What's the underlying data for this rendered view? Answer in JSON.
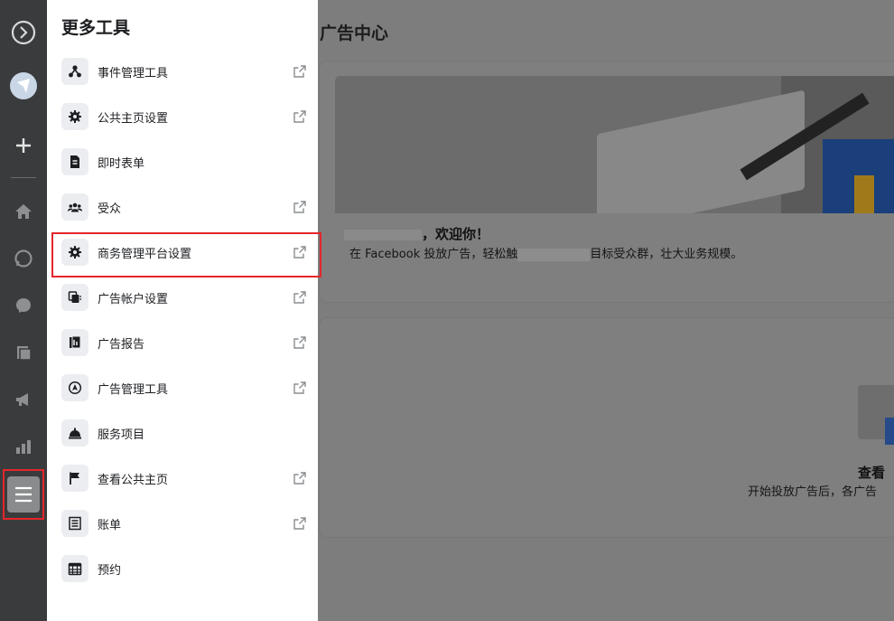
{
  "drawer": {
    "title": "更多工具",
    "items": [
      {
        "label": "事件管理工具",
        "icon": "events-manager-icon",
        "external": true
      },
      {
        "label": "公共主页设置",
        "icon": "gear-icon",
        "external": true
      },
      {
        "label": "即时表单",
        "icon": "form-icon",
        "external": false
      },
      {
        "label": "受众",
        "icon": "audience-icon",
        "external": true
      },
      {
        "label": "商务管理平台设置",
        "icon": "gear-icon",
        "external": true
      },
      {
        "label": "广告帐户设置",
        "icon": "ad-account-icon",
        "external": true
      },
      {
        "label": "广告报告",
        "icon": "report-icon",
        "external": true
      },
      {
        "label": "广告管理工具",
        "icon": "ads-manager-icon",
        "external": true
      },
      {
        "label": "服务项目",
        "icon": "service-bell-icon",
        "external": false
      },
      {
        "label": "查看公共主页",
        "icon": "flag-icon",
        "external": true
      },
      {
        "label": "账单",
        "icon": "billing-icon",
        "external": true
      },
      {
        "label": "预约",
        "icon": "calendar-icon",
        "external": false
      }
    ]
  },
  "main": {
    "title": "广告中心",
    "welcome": "，欢迎你！",
    "subline_start": "在 Facebook 投放广告，轻松触",
    "subline_end": "目标受众群，壮大业务规模。",
    "card2_title": "查看",
    "card2_sub": "开始投放广告后，各广告"
  },
  "colors": {
    "highlight": "#e4262b",
    "rail": "#3a3b3c",
    "overlay": "#7d7d7d"
  }
}
